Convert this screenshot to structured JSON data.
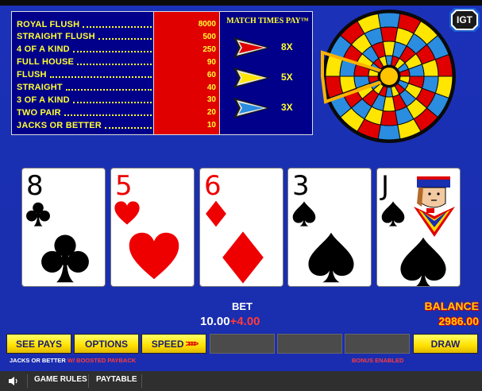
{
  "paytable": {
    "rows": [
      {
        "name": "ROYAL FLUSH",
        "pay": "8000"
      },
      {
        "name": "STRAIGHT FLUSH",
        "pay": "500"
      },
      {
        "name": "4 OF A KIND",
        "pay": "250"
      },
      {
        "name": "FULL HOUSE",
        "pay": "90"
      },
      {
        "name": "FLUSH",
        "pay": "60"
      },
      {
        "name": "STRAIGHT",
        "pay": "40"
      },
      {
        "name": "3 OF A KIND",
        "pay": "30"
      },
      {
        "name": "TWO PAIR",
        "pay": "20"
      },
      {
        "name": "JACKS OR BETTER",
        "pay": "10"
      }
    ],
    "match_title": "MATCH TIMES PAY™",
    "multipliers": [
      {
        "label": "8X",
        "color": "#e00000"
      },
      {
        "label": "5X",
        "color": "#ffe600"
      },
      {
        "label": "3X",
        "color": "#2a8de0"
      }
    ]
  },
  "logo": "IGT",
  "cards": [
    {
      "rank": "8",
      "suit": "clubs",
      "color": "black"
    },
    {
      "rank": "5",
      "suit": "hearts",
      "color": "red"
    },
    {
      "rank": "6",
      "suit": "diamonds",
      "color": "red"
    },
    {
      "rank": "3",
      "suit": "spades",
      "color": "black"
    },
    {
      "rank": "J",
      "suit": "spades",
      "color": "black",
      "face": "jack-of-spades"
    }
  ],
  "bet": {
    "label": "BET",
    "value": "10.00",
    "plus": "+4.00"
  },
  "balance": {
    "label": "BALANCE",
    "value": "2986.00"
  },
  "buttons": {
    "see_pays": "SEE PAYS",
    "options": "OPTIONS",
    "speed": "SPEED",
    "speed_arrows": ">>>>",
    "draw": "DRAW"
  },
  "game_name": "JACKS OR BETTER",
  "game_variant": " W/ BOOSTED PAYBACK",
  "bonus_status": "BONUS ENABLED",
  "footer": {
    "sound_icon": "speaker-icon",
    "game_rules": "GAME RULES",
    "paytable": "PAYTABLE"
  }
}
